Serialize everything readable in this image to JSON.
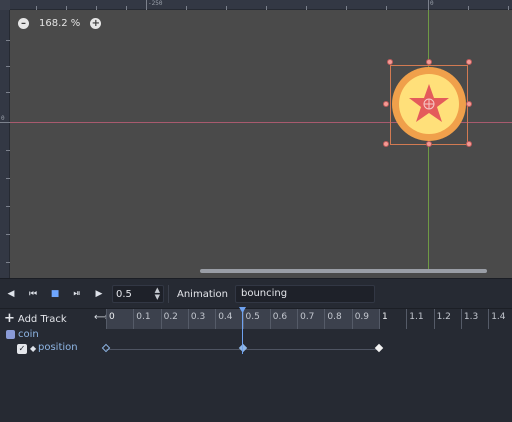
{
  "viewport": {
    "ruler_labels": {
      "top_left": "-250",
      "top_right": "0",
      "left": "0"
    },
    "zoom": {
      "minus": "–",
      "value": "168.2 %",
      "plus": "+"
    }
  },
  "toolbar": {
    "play_back_from_end": "◀",
    "play_back": "⏮",
    "stop": "■",
    "play_from_current": "⏯",
    "play_from_start": "▶",
    "step_value": "0.5",
    "animation_label": "Animation",
    "animation_name": "bouncing"
  },
  "tracks_header": {
    "add_track_label": "Add Track",
    "ticks": [
      "0",
      "0.1",
      "0.2",
      "0.3",
      "0.4",
      "0.5",
      "0.6",
      "0.7",
      "0.8",
      "0.9",
      "1",
      "1.1",
      "1.2",
      "1.3",
      "1.4"
    ]
  },
  "tracks": {
    "node_name": "coin",
    "property_name": "position",
    "keyframe_times": [
      0,
      0.5,
      1
    ],
    "current_time": 0.5
  },
  "colors": {
    "accent": "#6fa2f0",
    "selection": "#d27a52",
    "coin_outer": "#f0a04b",
    "coin_inner": "#ffe07a",
    "star": "#e45b5b"
  }
}
